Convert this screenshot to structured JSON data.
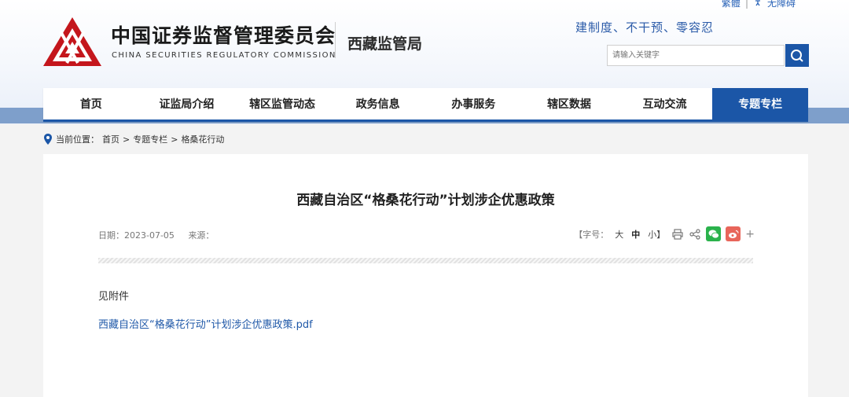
{
  "header": {
    "top_links": {
      "simplified": "繁體",
      "accessibility": "无障碍"
    },
    "logo_cn": "中国证券监督管理委员会",
    "logo_en": "CHINA SECURITIES REGULATORY COMMISSION",
    "sub_bureau": "西藏监管局",
    "slogan": "建制度、不干预、零容忍",
    "search_placeholder": "请输入关键字",
    "brand_color": "#c4161c",
    "accent_color": "#1b56a7"
  },
  "nav": {
    "items": [
      "首页",
      "证监局介绍",
      "辖区监管动态",
      "政务信息",
      "办事服务",
      "辖区数据",
      "互动交流",
      "专题专栏"
    ],
    "active_index": 7
  },
  "breadcrumb": {
    "label": "当前位置：",
    "items": [
      "首页",
      "专题专栏",
      "格桑花行动"
    ],
    "separator": ">"
  },
  "article": {
    "title": "西藏自治区“格桑花行动”计划涉企优惠政策",
    "date_label": "日期：2023-07-05",
    "source_label": "来源：",
    "font_size_label": "【字号：",
    "size_large": "大",
    "size_medium": "中",
    "size_small": "小】",
    "share_more": "+",
    "body": "见附件",
    "attachment": "西藏自治区“格桑花行动”计划涉企优惠政策.pdf"
  }
}
